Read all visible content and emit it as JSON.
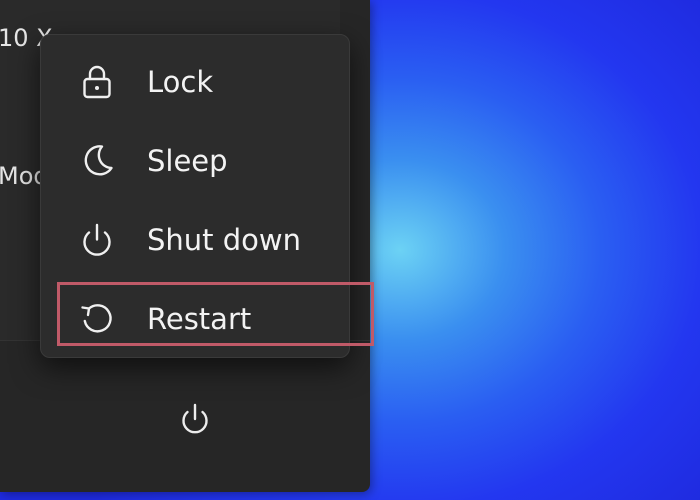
{
  "start_panel": {
    "partial_text_1": "10 X",
    "partial_text_2": "Mod"
  },
  "power_menu": {
    "items": [
      {
        "label": "Lock",
        "icon": "lock-icon"
      },
      {
        "label": "Sleep",
        "icon": "moon-icon"
      },
      {
        "label": "Shut down",
        "icon": "power-icon"
      },
      {
        "label": "Restart",
        "icon": "restart-icon"
      }
    ]
  },
  "footer": {
    "power_button_icon": "power-icon"
  },
  "highlight": {
    "target": "Restart",
    "color": "#c05a68"
  }
}
